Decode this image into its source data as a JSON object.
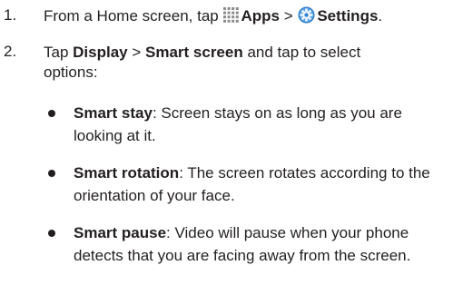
{
  "steps": [
    {
      "number": "1.",
      "prefix": "From a Home screen, tap ",
      "apps_label": "Apps",
      "separator": " > ",
      "settings_label": "Settings",
      "suffix": ".",
      "icons": [
        "apps-grid-icon",
        "settings-gear-icon"
      ]
    },
    {
      "number": "2.",
      "prefix": "Tap ",
      "display_label": "Display",
      "separator": " > ",
      "smart_screen_label": "Smart screen",
      "suffix": " and tap to select options:"
    }
  ],
  "options": [
    {
      "name": "Smart stay",
      "description": ": Screen stays on as long as you are looking at it."
    },
    {
      "name": "Smart rotation",
      "description": ": The screen rotates according to the orientation of your face."
    },
    {
      "name": "Smart pause",
      "description": ": Video will pause when your phone detects that you are facing away from the screen."
    }
  ],
  "colors": {
    "text": "#231f20",
    "settings_icon_blue": "#2f7fc8",
    "apps_icon_gray": "#8a8a8a"
  }
}
